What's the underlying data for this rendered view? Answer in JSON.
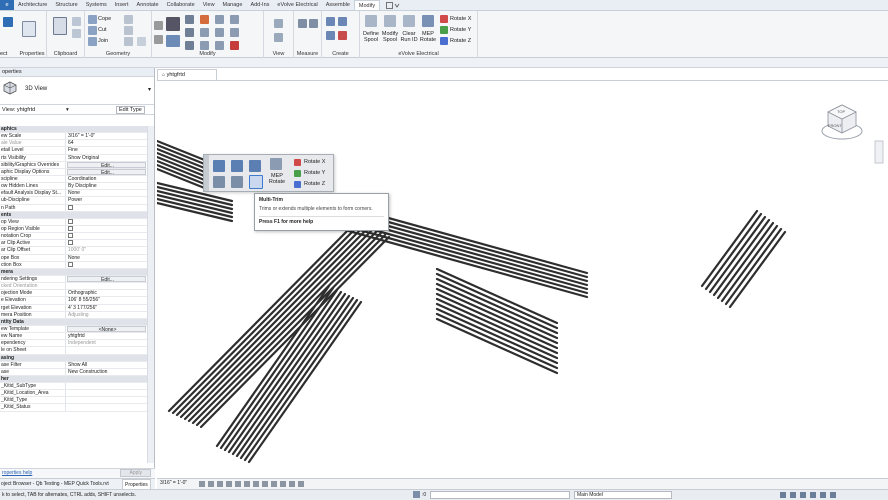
{
  "ribbon": {
    "tabs": [
      "Architecture",
      "Structure",
      "Systems",
      "Insert",
      "Annotate",
      "Collaborate",
      "View",
      "Manage",
      "Add-Ins",
      "eVolve Electrical",
      "Assemble",
      "Modify"
    ],
    "active_tab": "Modify",
    "panels": {
      "properties": "Properties",
      "clipboard": "Clipboard",
      "geometry": "Geometry",
      "modify": "Modify",
      "view": "View",
      "measure": "Measure",
      "create": "Create",
      "evolve": "eVolve Electrical"
    },
    "buttons": {
      "cope": "Cope",
      "cut": "Cut",
      "join": "Join",
      "define_spool": "Define Spool",
      "modify_spool": "Modify Spool",
      "clear_run_id": "Clear Run ID",
      "mep_rotate": "MEP Rotate",
      "rotate_x": "Rotate X",
      "rotate_y": "Rotate Y",
      "rotate_z": "Rotate Z",
      "partial_select": "ect",
      "partial_modify": "ify"
    }
  },
  "properties_panel": {
    "header": "operties",
    "type_name": "3D View",
    "view_selector": "View: yhtgfrtd",
    "edit_type": "Edit Type",
    "help_link": "roperties help",
    "apply": "Apply",
    "rows": [
      {
        "name": "aphics",
        "value": "",
        "group": true
      },
      {
        "name": "ew Scale",
        "value": "3/16\" = 1'-0\""
      },
      {
        "name": "ale Value",
        "value": "64",
        "grey_name": true
      },
      {
        "name": "etail Level",
        "value": "Fine"
      },
      {
        "name": "rts Visibility",
        "value": "Show Original"
      },
      {
        "name": "sibility/Graphics Overrides",
        "value": "Edit...",
        "button": true
      },
      {
        "name": "aphic Display Options",
        "value": "Edit...",
        "button": true
      },
      {
        "name": "scipline",
        "value": "Coordination"
      },
      {
        "name": "ow Hidden Lines",
        "value": "By Discipline"
      },
      {
        "name": "efault Analysis Display St...",
        "value": "None"
      },
      {
        "name": "ub-Discipline",
        "value": "Power"
      },
      {
        "name": "n Path",
        "value": "",
        "checkbox": true
      },
      {
        "name": "ents",
        "value": "",
        "group": true
      },
      {
        "name": "op View",
        "value": "",
        "checkbox": true
      },
      {
        "name": "op Region Visible",
        "value": "",
        "checkbox": true
      },
      {
        "name": "notation Crop",
        "value": "",
        "checkbox": true
      },
      {
        "name": "ar Clip Active",
        "value": "",
        "checkbox": true
      },
      {
        "name": "ar Clip Offset",
        "value": "1000' 0\"",
        "grey": true
      },
      {
        "name": "ope Box",
        "value": "None"
      },
      {
        "name": "ction Box",
        "value": "",
        "checkbox": true
      },
      {
        "name": "mera",
        "value": "",
        "group": true
      },
      {
        "name": "ndering Settings",
        "value": "Edit...",
        "button": true
      },
      {
        "name": "cked Orientation",
        "value": "",
        "grey_name": true
      },
      {
        "name": "ojection Mode",
        "value": "Orthographic"
      },
      {
        "name": "e Elevation",
        "value": "106' 8 55/256\""
      },
      {
        "name": "rget Elevation",
        "value": "4' 3 177/256\""
      },
      {
        "name": "mera Position",
        "value": "Adjusting",
        "grey": true
      },
      {
        "name": "ntity Data",
        "value": "",
        "group": true
      },
      {
        "name": "ew Template",
        "value": "<None>",
        "button": true
      },
      {
        "name": "ew Name",
        "value": "yhtgfrtd"
      },
      {
        "name": "ependency",
        "value": "Independent",
        "grey": true
      },
      {
        "name": "le on Sheet",
        "value": ""
      },
      {
        "name": "asing",
        "value": "",
        "group": true
      },
      {
        "name": "ase Filter",
        "value": "Show All"
      },
      {
        "name": "ase",
        "value": "New Construction"
      },
      {
        "name": "her",
        "value": "",
        "group": true
      },
      {
        "name": "_Kitid_SubType",
        "value": ""
      },
      {
        "name": "_Kitid_Location_Area",
        "value": ""
      },
      {
        "name": "_Kitid_Type",
        "value": ""
      },
      {
        "name": "_Kitid_Status",
        "value": ""
      }
    ]
  },
  "view": {
    "tab_title": "yhtgfrtd",
    "scale": "3/16\" = 1'-0\"",
    "viewcube": {
      "top": "TOP",
      "front": "FRONT"
    }
  },
  "floating_toolbar": {
    "rotate_x": "Rotate X",
    "rotate_y": "Rotate Y",
    "rotate_z": "Rotate Z",
    "mep_rotate": "MEP Rotate"
  },
  "tooltip": {
    "title": "Multi-Trim",
    "description": "Trims or extends multiple elements to form corners.",
    "help": "Press F1 for more help"
  },
  "bottom_tabs": {
    "text": "oject Browser - Qb Testing - MEP Quick Tools.rvt",
    "properties": "Properties"
  },
  "status": {
    "message": "k to select, TAB for alternates, CTRL adds, SHIFT unselects.",
    "zero": ":0",
    "model": "Main Model"
  },
  "colors": {
    "accent": "#2f6db5",
    "conduit": "#3a3a3a",
    "ribbon_bg": "#f5f6f8"
  }
}
